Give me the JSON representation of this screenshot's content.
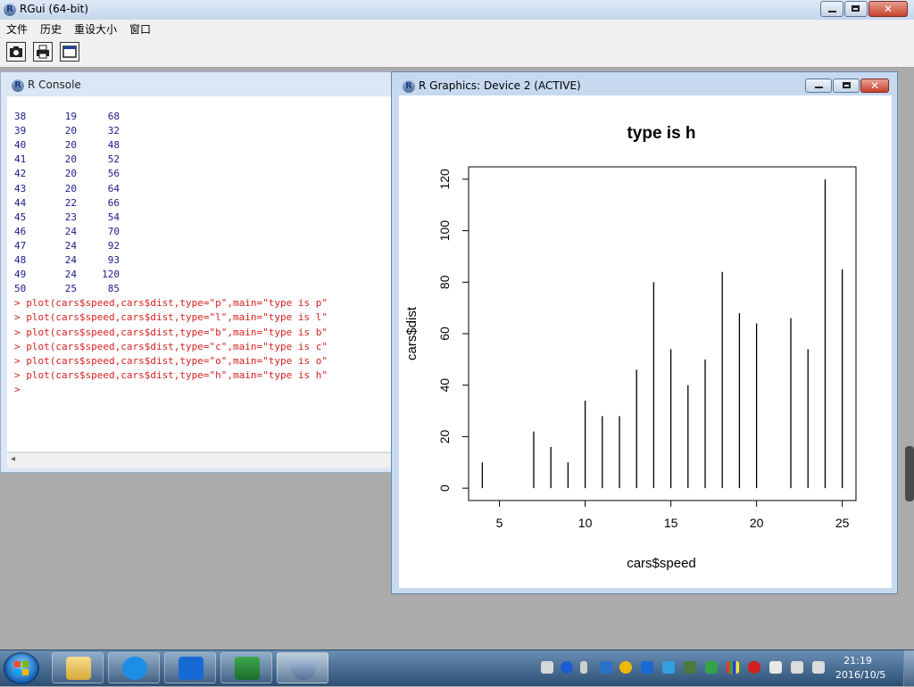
{
  "app": {
    "title": "RGui (64-bit)",
    "icon": "r-logo-icon"
  },
  "menu": [
    "文件",
    "历史",
    "重设大小",
    "窗口"
  ],
  "toolbar": {
    "buttons": [
      "camera-icon",
      "printer-icon",
      "window-icon"
    ]
  },
  "console": {
    "title": "R Console",
    "output_rows": [
      [
        "38",
        "19",
        "68"
      ],
      [
        "39",
        "20",
        "32"
      ],
      [
        "40",
        "20",
        "48"
      ],
      [
        "41",
        "20",
        "52"
      ],
      [
        "42",
        "20",
        "56"
      ],
      [
        "43",
        "20",
        "64"
      ],
      [
        "44",
        "22",
        "66"
      ],
      [
        "45",
        "23",
        "54"
      ],
      [
        "46",
        "24",
        "70"
      ],
      [
        "47",
        "24",
        "92"
      ],
      [
        "48",
        "24",
        "93"
      ],
      [
        "49",
        "24",
        "120"
      ],
      [
        "50",
        "25",
        "85"
      ]
    ],
    "commands": [
      "> plot(cars$speed,cars$dist,type=\"p\",main=\"type is p\"",
      "> plot(cars$speed,cars$dist,type=\"l\",main=\"type is l\"",
      "> plot(cars$speed,cars$dist,type=\"b\",main=\"type is b\"",
      "> plot(cars$speed,cars$dist,type=\"c\",main=\"type is c\"",
      "> plot(cars$speed,cars$dist,type=\"o\",main=\"type is o\"",
      "> plot(cars$speed,cars$dist,type=\"h\",main=\"type is h\""
    ],
    "prompt": ">",
    "colors": {
      "output": "#1a1a8a",
      "command": "#d42020"
    }
  },
  "graphics_window": {
    "title": "R Graphics: Device 2 (ACTIVE)"
  },
  "chart_data": {
    "type": "bar",
    "render": "histogram-like vertical lines (type h)",
    "title": "type is h",
    "xlabel": "cars$speed",
    "ylabel": "cars$dist",
    "xlim": [
      4,
      25
    ],
    "ylim": [
      0,
      120
    ],
    "xticks": [
      5,
      10,
      15,
      20,
      25
    ],
    "yticks": [
      0,
      20,
      40,
      60,
      80,
      100,
      120
    ],
    "x": [
      4,
      7,
      8,
      9,
      10,
      11,
      12,
      13,
      14,
      15,
      16,
      17,
      18,
      19,
      20,
      22,
      23,
      24,
      25
    ],
    "y": [
      10,
      22,
      16,
      10,
      34,
      28,
      28,
      46,
      80,
      54,
      40,
      50,
      84,
      68,
      64,
      66,
      54,
      120,
      85
    ],
    "grid": false
  },
  "taskbar": {
    "apps": [
      "folder-icon",
      "sogou-icon",
      "shield-icon",
      "excel-icon",
      "r-logo-icon"
    ],
    "clock": {
      "time": "21:19",
      "date": "2016/10/5"
    }
  }
}
